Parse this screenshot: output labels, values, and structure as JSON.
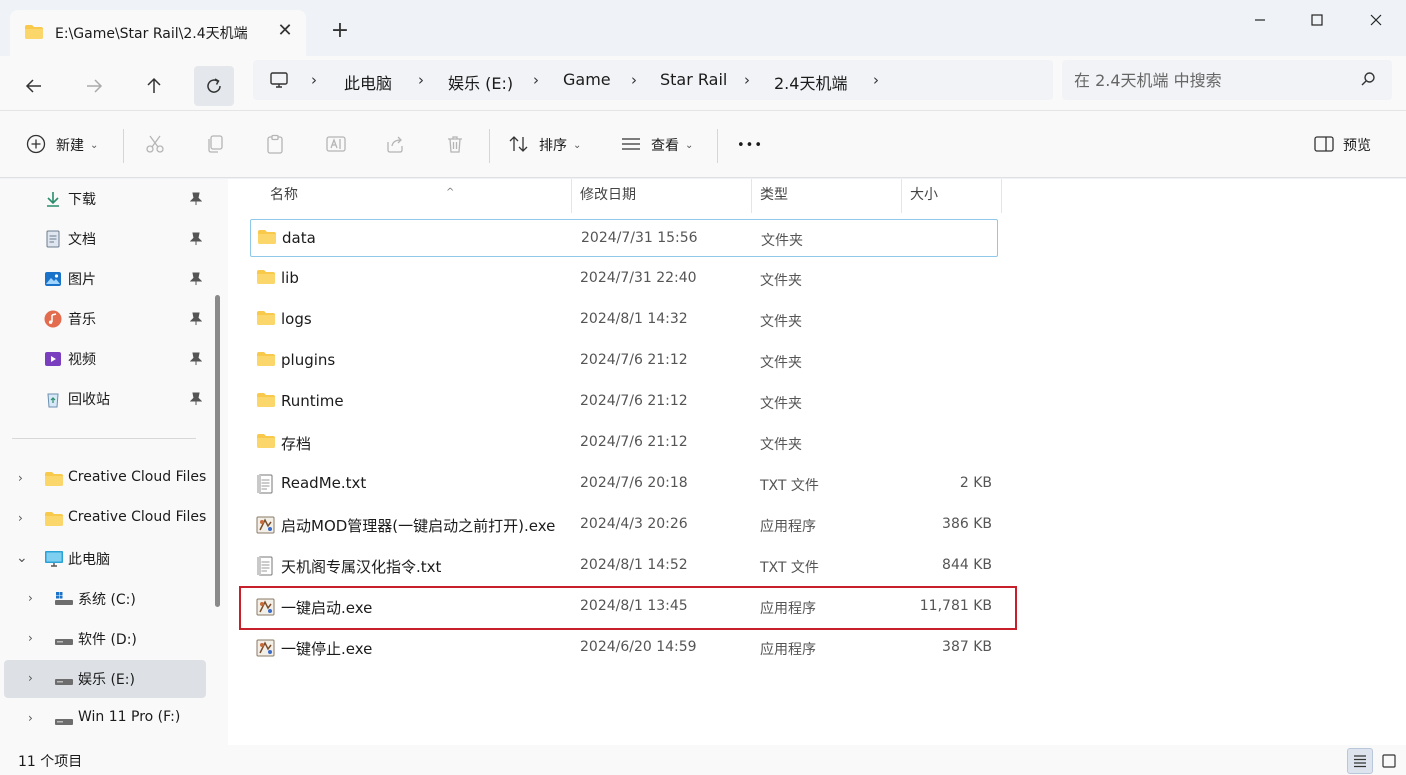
{
  "tab": {
    "title": "E:\\Game\\Star Rail\\2.4天机端",
    "close": "✕",
    "new_tab": "+"
  },
  "window": {
    "minimize_icon": "minimize-icon",
    "maximize_icon": "maximize-icon",
    "close_icon": "close-icon"
  },
  "breadcrumb": [
    "此电脑",
    "娱乐 (E:)",
    "Game",
    "Star Rail",
    "2.4天机端"
  ],
  "search": {
    "placeholder": "在 2.4天机端 中搜索"
  },
  "toolbar": {
    "new_label": "新建",
    "sort_label": "排序",
    "view_label": "查看",
    "more_label": "•••",
    "preview_label": "预览"
  },
  "sidebar": {
    "quick_access": [
      {
        "label": "下载",
        "icon": "download-icon"
      },
      {
        "label": "文档",
        "icon": "document-icon"
      },
      {
        "label": "图片",
        "icon": "pictures-icon"
      },
      {
        "label": "音乐",
        "icon": "music-icon"
      },
      {
        "label": "视频",
        "icon": "video-icon"
      },
      {
        "label": "回收站",
        "icon": "recycle-bin-icon"
      }
    ],
    "tree": [
      {
        "label": "Creative Cloud Files",
        "icon": "folder-icon"
      },
      {
        "label": "Creative Cloud Files",
        "icon": "folder-icon"
      },
      {
        "label": "此电脑",
        "icon": "pc-icon"
      },
      {
        "label": "系统 (C:)",
        "icon": "system-drive-icon"
      },
      {
        "label": "软件 (D:)",
        "icon": "drive-icon"
      },
      {
        "label": "娱乐 (E:)",
        "icon": "drive-icon"
      },
      {
        "label": "Win 11 Pro (F:)",
        "icon": "drive-icon"
      }
    ]
  },
  "columns": {
    "name": "名称",
    "date": "修改日期",
    "type": "类型",
    "size": "大小"
  },
  "files": [
    {
      "name": "data",
      "date": "2024/7/31 15:56",
      "type": "文件夹",
      "size": "",
      "icon": "folder-icon"
    },
    {
      "name": "lib",
      "date": "2024/7/31 22:40",
      "type": "文件夹",
      "size": "",
      "icon": "folder-icon"
    },
    {
      "name": "logs",
      "date": "2024/8/1 14:32",
      "type": "文件夹",
      "size": "",
      "icon": "folder-icon"
    },
    {
      "name": "plugins",
      "date": "2024/7/6 21:12",
      "type": "文件夹",
      "size": "",
      "icon": "folder-icon"
    },
    {
      "name": "Runtime",
      "date": "2024/7/6 21:12",
      "type": "文件夹",
      "size": "",
      "icon": "folder-icon"
    },
    {
      "name": "存档",
      "date": "2024/7/6 21:12",
      "type": "文件夹",
      "size": "",
      "icon": "folder-icon"
    },
    {
      "name": "ReadMe.txt",
      "date": "2024/7/6 20:18",
      "type": "TXT 文件",
      "size": "2 KB",
      "icon": "text-file-icon"
    },
    {
      "name": "启动MOD管理器(一键启动之前打开).exe",
      "date": "2024/4/3 20:26",
      "type": "应用程序",
      "size": "386 KB",
      "icon": "exe-icon"
    },
    {
      "name": "天机阁专属汉化指令.txt",
      "date": "2024/8/1 14:52",
      "type": "TXT 文件",
      "size": "844 KB",
      "icon": "text-file-icon"
    },
    {
      "name": "一键启动.exe",
      "date": "2024/8/1 13:45",
      "type": "应用程序",
      "size": "11,781 KB",
      "icon": "exe-icon"
    },
    {
      "name": "一键停止.exe",
      "date": "2024/6/20 14:59",
      "type": "应用程序",
      "size": "387 KB",
      "icon": "exe-icon"
    }
  ],
  "status": {
    "count": "11 个项目"
  },
  "colors": {
    "highlight": "#c8202a",
    "folder": "#f8c94a",
    "accent": "#0067c0"
  }
}
